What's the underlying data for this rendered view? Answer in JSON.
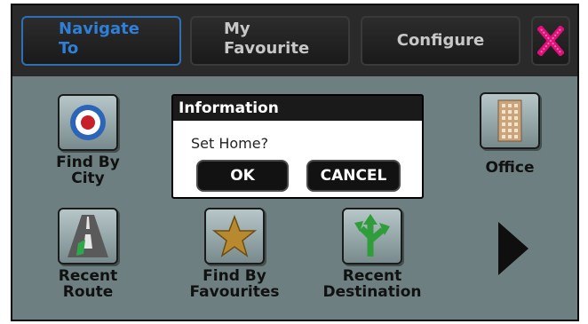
{
  "tabs": [
    {
      "label": "Navigate\nTo",
      "active": true
    },
    {
      "label": "My\nFavourite",
      "active": false
    },
    {
      "label": "Configure",
      "active": false
    }
  ],
  "close": {
    "icon": "close-x-icon",
    "color": "#e0107a"
  },
  "menu": {
    "find_by_city": "Find By\nCity",
    "office": "Office",
    "recent_route": "Recent\nRoute",
    "find_by_favourites": "Find By\nFavourites",
    "recent_destination": "Recent\nDestination"
  },
  "dialog": {
    "title": "Information",
    "message": "Set Home?",
    "ok": "OK",
    "cancel": "CANCEL"
  },
  "colors": {
    "active_tab": "#2f7fd6",
    "panel_bg": "#6d7f80"
  }
}
